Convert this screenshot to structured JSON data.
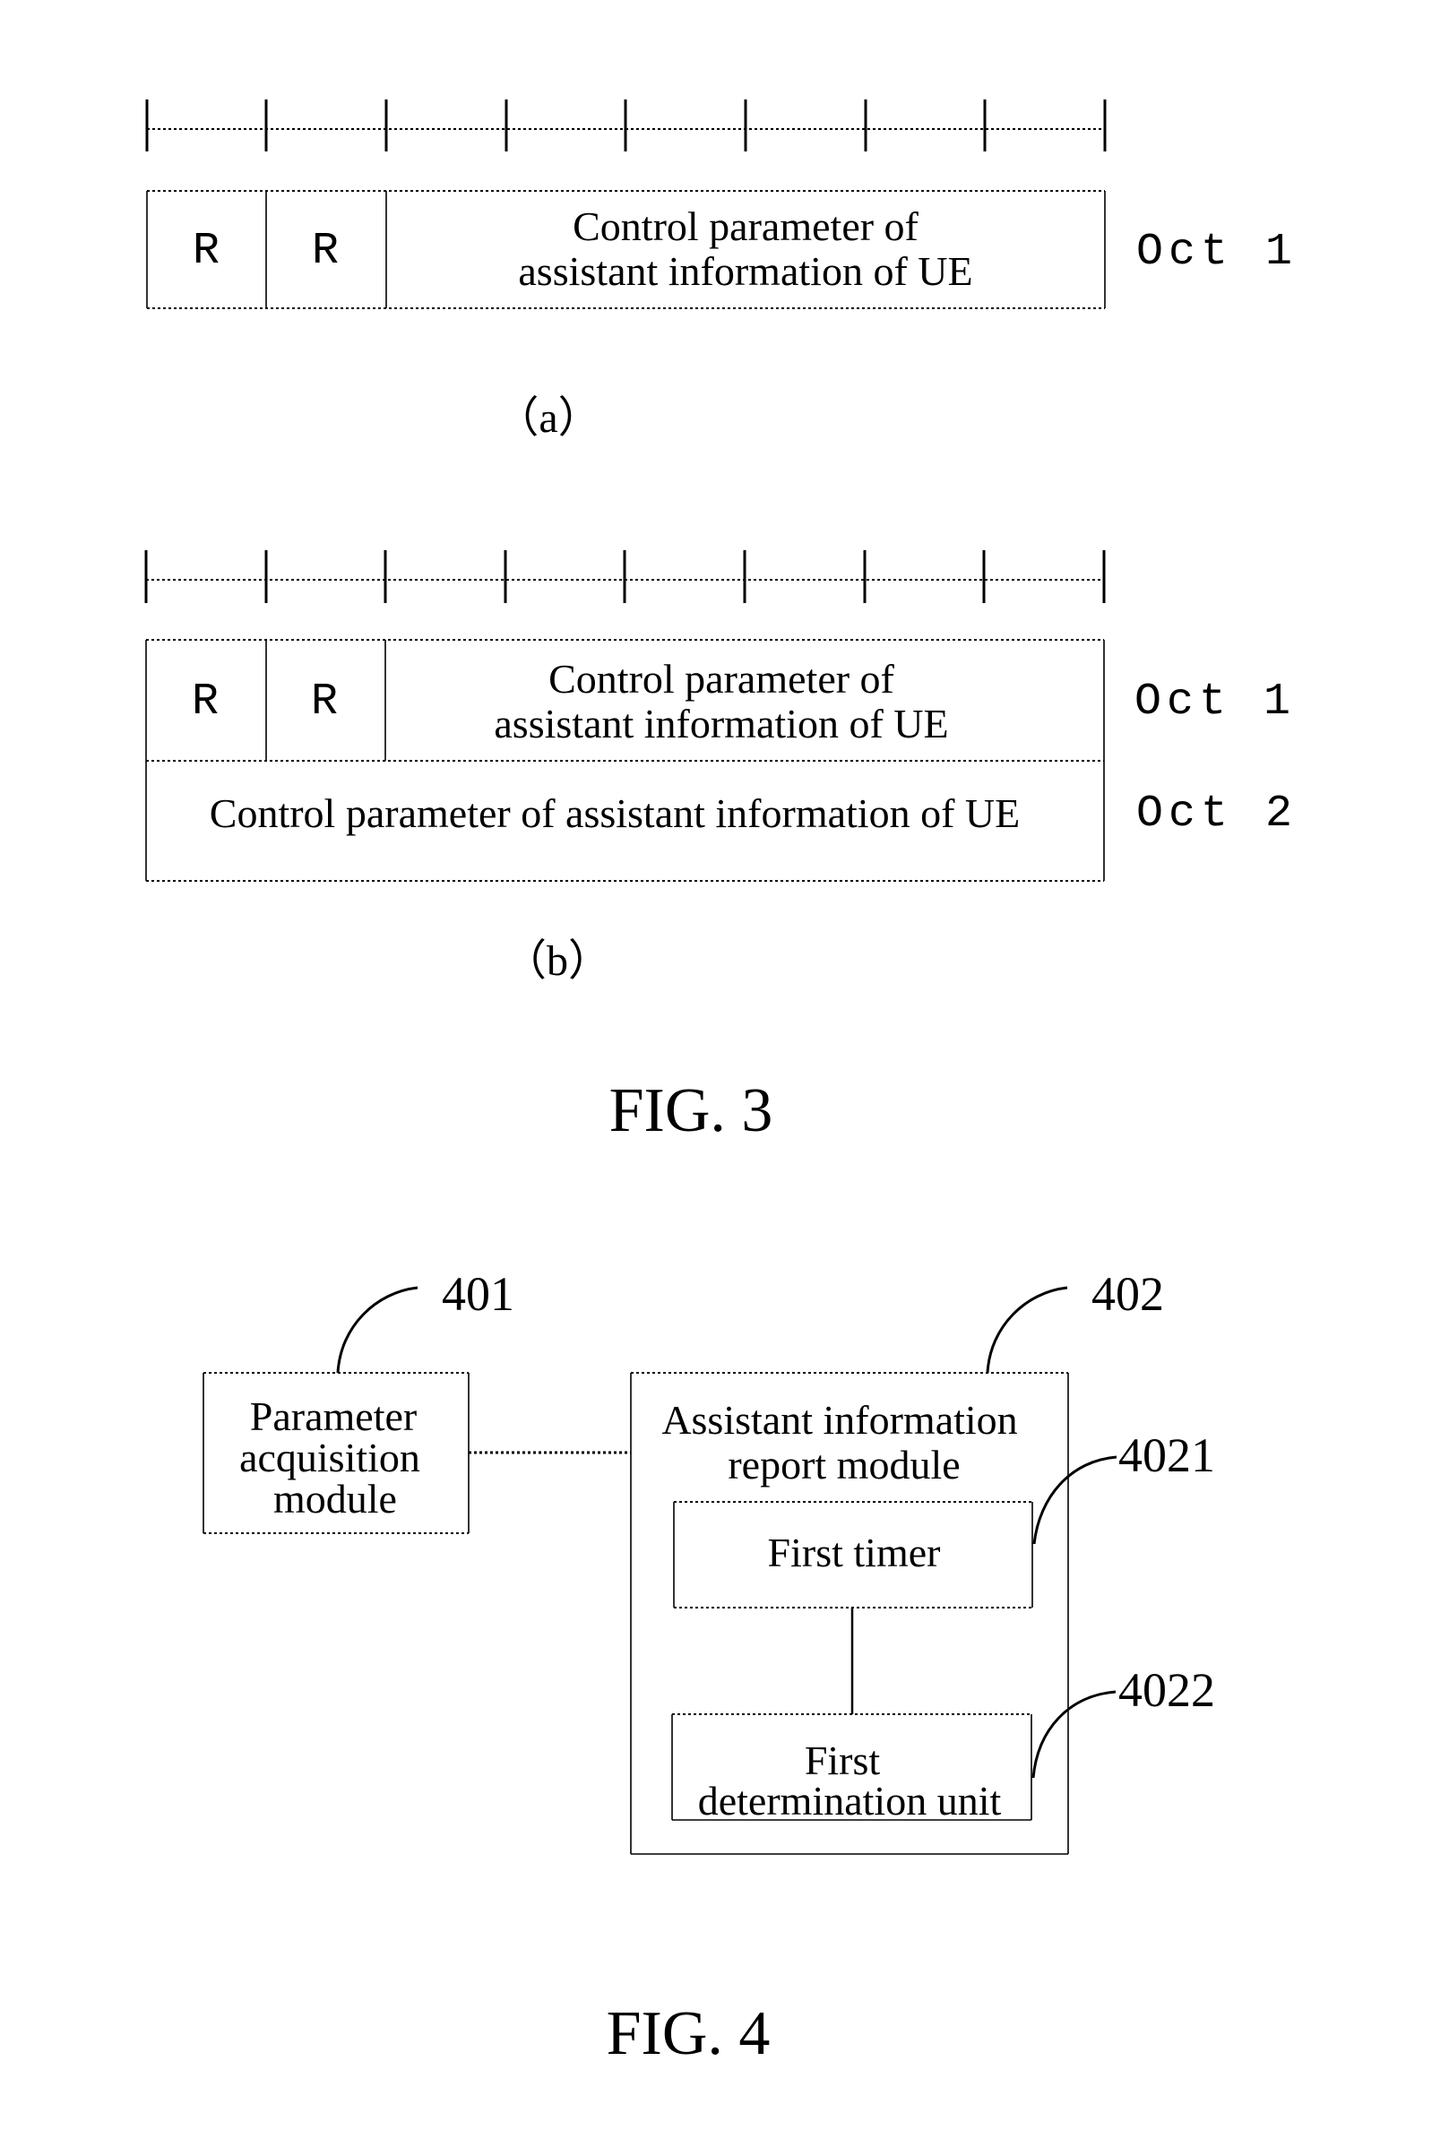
{
  "fig3": {
    "title": "FIG. 3",
    "bit_columns": 8,
    "a": {
      "label": "（a）",
      "reserved_1": "R",
      "reserved_2": "R",
      "field_line1": "Control parameter of",
      "field_line2": "assistant information of UE",
      "octet": "Oct 1"
    },
    "b": {
      "label": "（b）",
      "reserved_1": "R",
      "reserved_2": "R",
      "field_line1": "Control parameter of",
      "field_line2": "assistant information of UE",
      "octet1": "Oct 1",
      "row2_text": "Control parameter of assistant information of UE",
      "octet2": "Oct 2"
    }
  },
  "fig4": {
    "title": "FIG. 4",
    "module_401": {
      "ref": "401",
      "line1": "Parameter",
      "line2": "acquisition",
      "line3": "module"
    },
    "module_402": {
      "ref": "402",
      "line1": "Assistant information",
      "line2": "report module"
    },
    "unit_4021": {
      "ref": "4021",
      "label": "First timer"
    },
    "unit_4022": {
      "ref": "4022",
      "line1": "First",
      "line2": "determination unit"
    }
  }
}
